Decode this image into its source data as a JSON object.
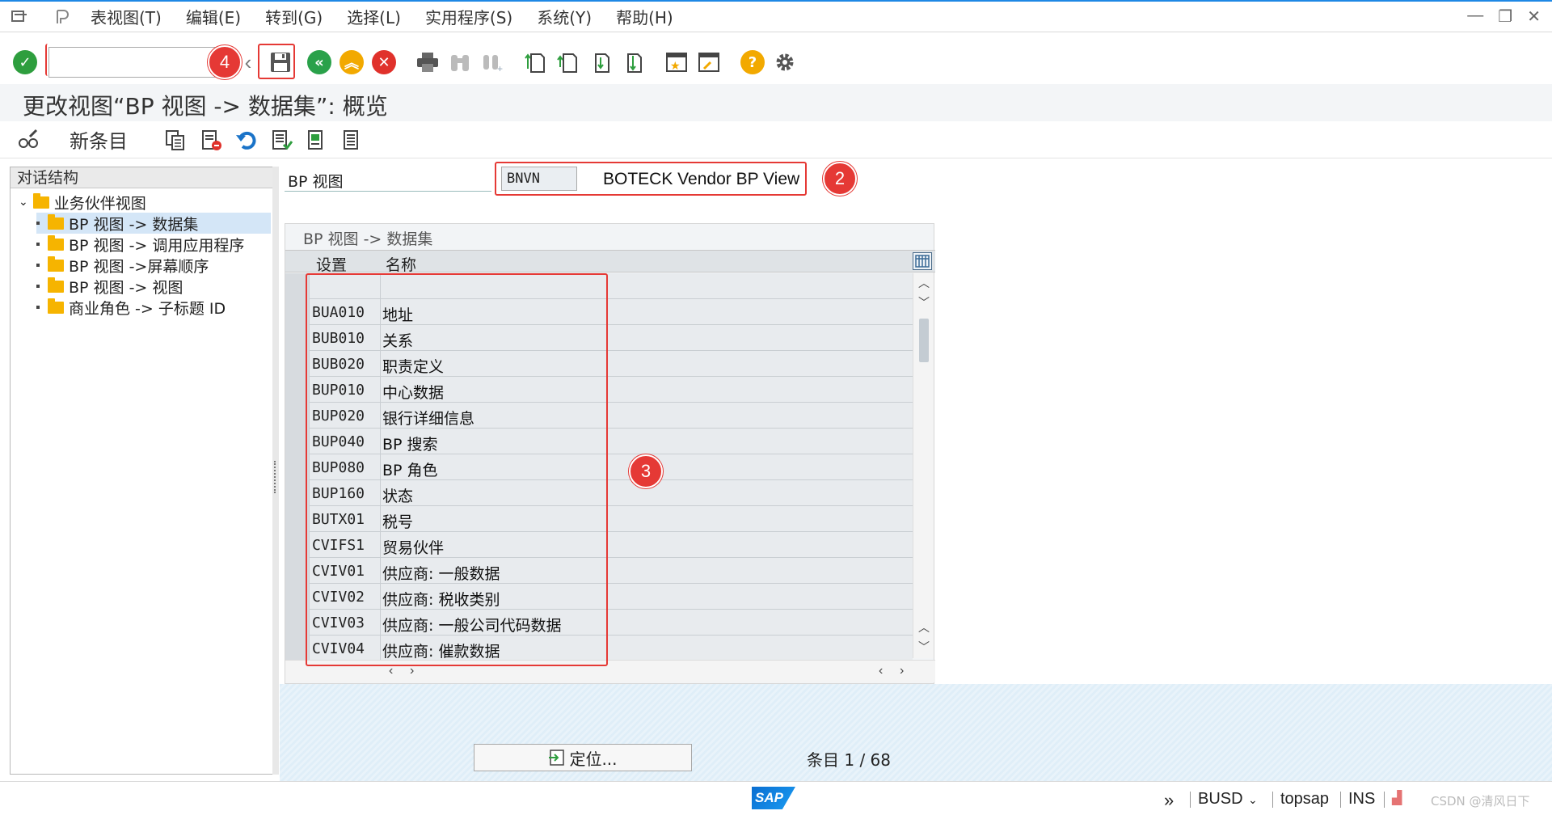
{
  "menu": {
    "items": [
      "表视图(T)",
      "编辑(E)",
      "转到(G)",
      "选择(L)",
      "实用程序(S)",
      "系统(Y)",
      "帮助(H)"
    ]
  },
  "toolbar": {
    "command_value": "",
    "callout_4": "4"
  },
  "title": {
    "text": "更改视图“BP 视图 -> 数据集”: 概览"
  },
  "app_toolbar": {
    "new_entries": "新条目"
  },
  "tree": {
    "header": "对话结构",
    "root": "业务伙伴视图",
    "children": [
      "BP 视图 -> 数据集",
      "BP 视图 -> 调用应用程序",
      "BP 视图 ->屏幕顺序",
      "BP 视图 -> 视图",
      "商业角色 -> 子标题 ID"
    ]
  },
  "bp_view": {
    "label": "BP 视图",
    "code": "BNVN",
    "description": "BOTECK Vendor BP View",
    "callout_2": "2"
  },
  "table": {
    "title": "BP 视图 -> 数据集",
    "headers": {
      "setting": "设置",
      "name": "名称"
    },
    "rows": [
      {
        "code": "",
        "name": ""
      },
      {
        "code": "BUA010",
        "name": "地址"
      },
      {
        "code": "BUB010",
        "name": "关系"
      },
      {
        "code": "BUB020",
        "name": "职责定义"
      },
      {
        "code": "BUP010",
        "name": "中心数据"
      },
      {
        "code": "BUP020",
        "name": "银行详细信息"
      },
      {
        "code": "BUP040",
        "name": "BP 搜索"
      },
      {
        "code": "BUP080",
        "name": "BP 角色"
      },
      {
        "code": "BUP160",
        "name": "状态"
      },
      {
        "code": "BUTX01",
        "name": "税号"
      },
      {
        "code": "CVIFS1",
        "name": "贸易伙伴"
      },
      {
        "code": "CVIV01",
        "name": "供应商: 一般数据"
      },
      {
        "code": "CVIV02",
        "name": "供应商: 税收类别"
      },
      {
        "code": "CVIV03",
        "name": "供应商: 一般公司代码数据"
      },
      {
        "code": "CVIV04",
        "name": "供应商: 催款数据"
      }
    ],
    "callout_3": "3"
  },
  "bottom": {
    "position_button": "定位...",
    "entry_count": "条目 1 / 68"
  },
  "status": {
    "sap_logo": "SAP",
    "system": "BUSD",
    "host": "topsap",
    "mode": "INS",
    "watermark": "CSDN @清风日下"
  },
  "colors": {
    "accent": "#1e88e5",
    "callout_red": "#e53935",
    "ok_green": "#2e9e3e",
    "nav_green": "#2aa14a",
    "nav_orange": "#f2a900",
    "cancel_red": "#e0312b",
    "folder": "#f6b400"
  }
}
